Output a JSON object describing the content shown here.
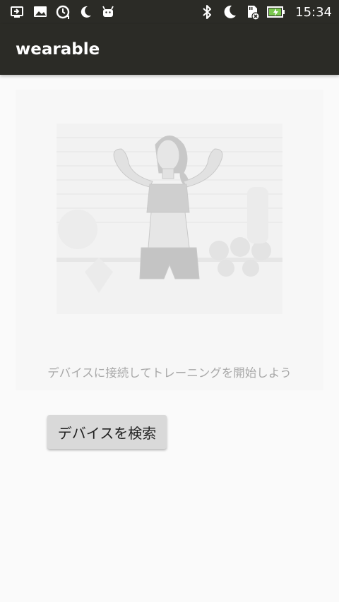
{
  "status_bar": {
    "left_icons": [
      "screen-cast-icon",
      "image-icon",
      "sync-clock-icon",
      "moon-icon",
      "android-icon"
    ],
    "right_icons": [
      "bluetooth-icon",
      "moon-icon",
      "sd-card-error-icon",
      "battery-charging-icon"
    ],
    "time": "15:34"
  },
  "app_bar": {
    "title": "wearable"
  },
  "hero": {
    "illustration": "fitness-woman-flexing-image",
    "caption": "デバイスに接続してトレーニングを開始しよう"
  },
  "actions": {
    "search_device_label": "デバイスを検索"
  },
  "colors": {
    "bar_background": "#2b2b26",
    "page_background": "#fafafa",
    "button_background": "#d9d9d9",
    "caption_text": "#a9a9a9"
  }
}
